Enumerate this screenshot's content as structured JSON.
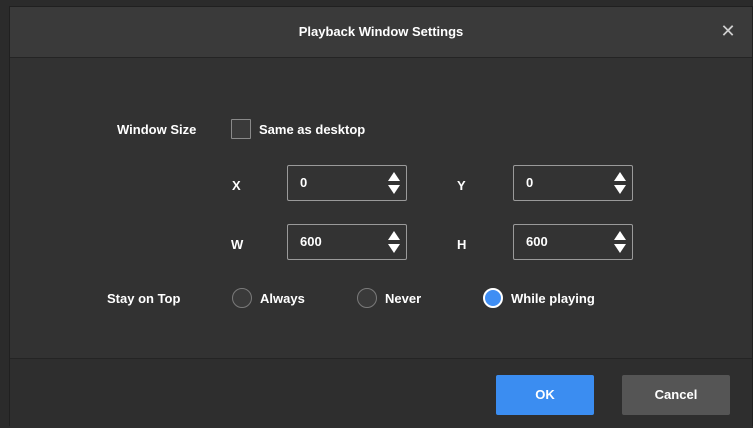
{
  "dialog": {
    "title": "Playback Window Settings",
    "close_glyph": "✕"
  },
  "window_size": {
    "label": "Window Size",
    "same_as_desktop_label": "Same as desktop",
    "same_as_desktop_checked": false,
    "x_label": "X",
    "x_value": "0",
    "y_label": "Y",
    "y_value": "0",
    "w_label": "W",
    "w_value": "600",
    "h_label": "H",
    "h_value": "600"
  },
  "stay_on_top": {
    "label": "Stay on Top",
    "options": [
      "Always",
      "Never",
      "While playing"
    ],
    "selected": "While playing"
  },
  "buttons": {
    "ok": "OK",
    "cancel": "Cancel"
  },
  "colors": {
    "accent": "#3b8df1",
    "background": "#323232"
  }
}
